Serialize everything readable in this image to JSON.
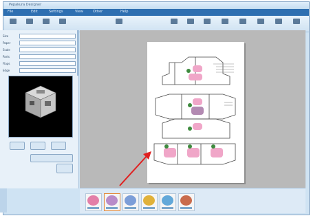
{
  "window": {
    "title": "Pepakura Designer"
  },
  "menu": {
    "items": [
      "File",
      "Edit",
      "Settings",
      "View",
      "Other",
      "Help"
    ]
  },
  "toolbar": {
    "buttons": [
      {
        "icon": "open-icon"
      },
      {
        "icon": "save-icon"
      },
      {
        "icon": "print-icon"
      },
      {
        "icon": "unfold-icon"
      },
      {
        "icon": "rotate-icon"
      },
      {
        "icon": "move-icon"
      },
      {
        "icon": "zoom-icon"
      },
      {
        "icon": "edit-icon"
      },
      {
        "icon": "fold-icon"
      },
      {
        "icon": "glue-icon"
      },
      {
        "icon": "help-icon"
      }
    ]
  },
  "properties": {
    "rows": [
      {
        "label": "Size",
        "value": ""
      },
      {
        "label": "Paper",
        "value": ""
      },
      {
        "label": "Scale",
        "value": ""
      },
      {
        "label": "Parts",
        "value": ""
      },
      {
        "label": "Flaps",
        "value": ""
      },
      {
        "label": "Edge",
        "value": ""
      }
    ]
  },
  "thumbnails": [
    {
      "color": "#e37fa8"
    },
    {
      "color": "#b88cc9"
    },
    {
      "color": "#7c9ed8"
    },
    {
      "color": "#e0b13a"
    },
    {
      "color": "#62a8d9"
    },
    {
      "color": "#c96b4c"
    }
  ],
  "colors": {
    "accent": "#2e6fb1",
    "arrow": "#e02020",
    "cube_pink": "#f0a6c8",
    "cube_green": "#3e8a3e"
  }
}
